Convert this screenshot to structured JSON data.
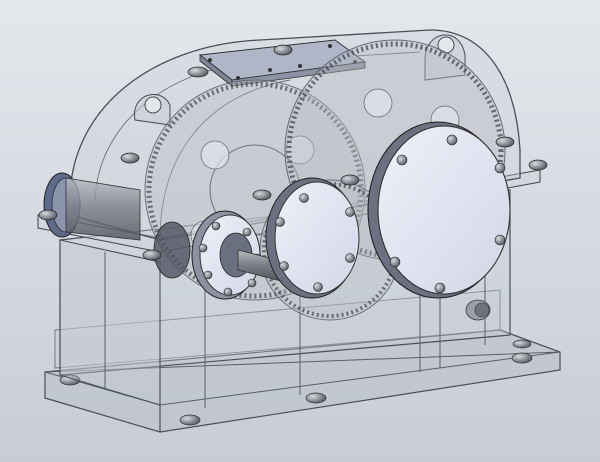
{
  "scene": {
    "watermark": "",
    "colors": {
      "background_top": "#e4e7ec",
      "background_bottom": "#c8cdd5",
      "housing_fill": "#c9ced6",
      "housing_edge": "#4a4f57",
      "cover_face": "#dfe2f1",
      "shaft_metal": "#8c9099",
      "gear_metal": "#b7bbc2"
    },
    "icons": {
      "gearbox": "reduction-gearbox-icon",
      "gear": "gear-icon",
      "bolt": "bolt-icon"
    }
  }
}
